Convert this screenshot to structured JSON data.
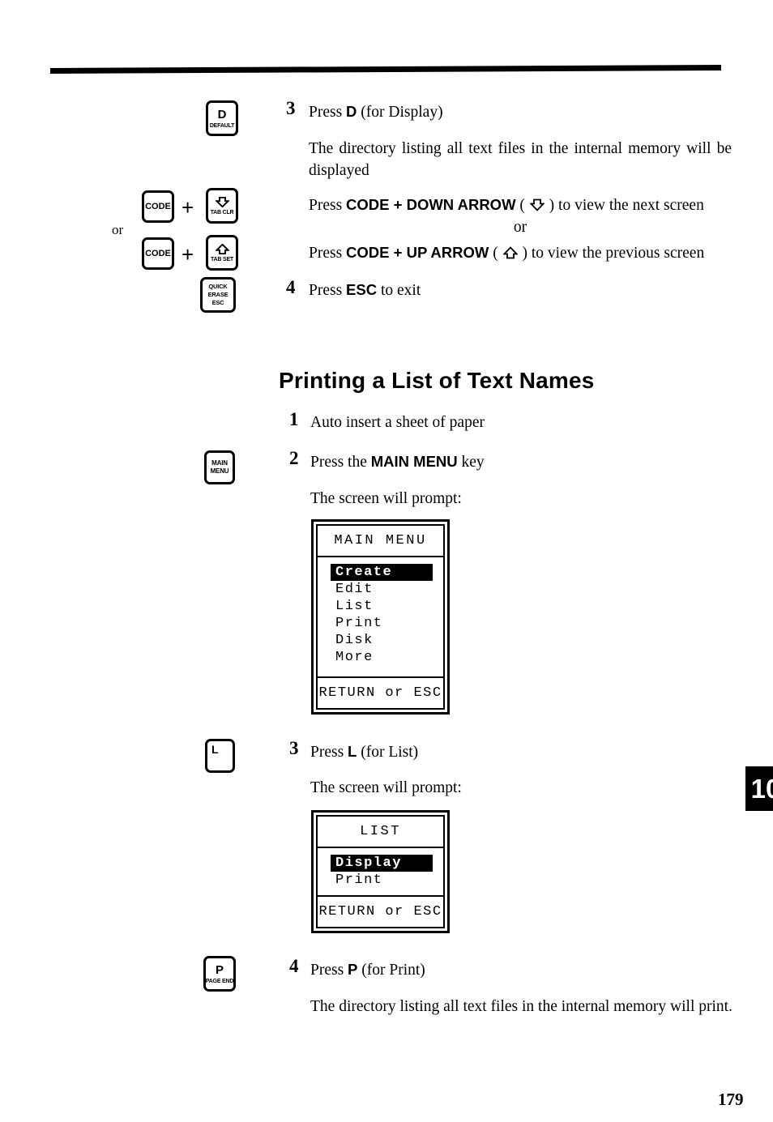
{
  "page": {
    "number": "179",
    "chapter_tab": "10"
  },
  "top_section": {
    "step3": {
      "num": "3",
      "text_pre": "Press ",
      "key": "D",
      "text_post": " (for Display)"
    },
    "result_text": "The directory listing all text files in the internal memory will be displayed",
    "down_line": {
      "press": "Press ",
      "combo": "CODE + DOWN ARROW",
      "paren_open": " ( ",
      "arrow": "down-arrow-glyph",
      "paren_close": " ) ",
      "tail": "to view the next screen"
    },
    "or_label": "or",
    "up_line": {
      "press": "Press ",
      "combo": "CODE + UP ARROW",
      "paren_open": " ( ",
      "arrow": "up-arrow-glyph",
      "paren_close": " ) ",
      "tail": "to view the previous screen"
    },
    "step4": {
      "num": "4",
      "text_pre": "Press ",
      "key": "ESC",
      "text_post": " to exit"
    },
    "margin_or": "or"
  },
  "keys": {
    "default_key": {
      "main": "D",
      "sub": "DEFAULT"
    },
    "code_key_1": {
      "main": "CODE"
    },
    "code_key_2": {
      "main": "CODE"
    },
    "tab_clr_key": {
      "sub": "TAB CLR",
      "arrow": "down"
    },
    "tab_set_key": {
      "sub": "TAB SET",
      "arrow": "up"
    },
    "quick_erase_key": {
      "line1": "QUICK",
      "line2": "ERASE",
      "line3": "ESC"
    },
    "main_menu_key": {
      "line1": "MAIN",
      "line2": "MENU"
    },
    "l_key": {
      "main": "L"
    },
    "p_key": {
      "main": "P",
      "sub": "PAGE END"
    },
    "plus_1": "+",
    "plus_2": "+"
  },
  "heading": "Printing a List of Text Names",
  "print_section": {
    "step1": {
      "num": "1",
      "text": "Auto insert a sheet of paper"
    },
    "step2": {
      "num": "2",
      "text_pre": "Press the ",
      "key": "MAIN MENU",
      "text_post": " key"
    },
    "prompt1": "The screen will prompt:",
    "step3": {
      "num": "3",
      "text_pre": "Press ",
      "key": "L",
      "text_post": " (for List)"
    },
    "prompt2": "The screen will prompt:",
    "step4": {
      "num": "4",
      "text_pre": "Press ",
      "key": "P",
      "text_post": " (for Print)"
    },
    "result_text": "The directory listing all text files in the internal memory will print."
  },
  "screens": {
    "main_menu": {
      "title": "MAIN MENU",
      "items": [
        "Create",
        "Edit",
        "List",
        "Print",
        "Disk",
        "More"
      ],
      "selected_index": 0,
      "footer": "RETURN or ESC"
    },
    "list": {
      "title": "LIST",
      "items": [
        "Display",
        "Print"
      ],
      "selected_index": 0,
      "footer": "RETURN or ESC"
    }
  },
  "colors": {
    "ink": "#000000",
    "paper": "#ffffff"
  }
}
